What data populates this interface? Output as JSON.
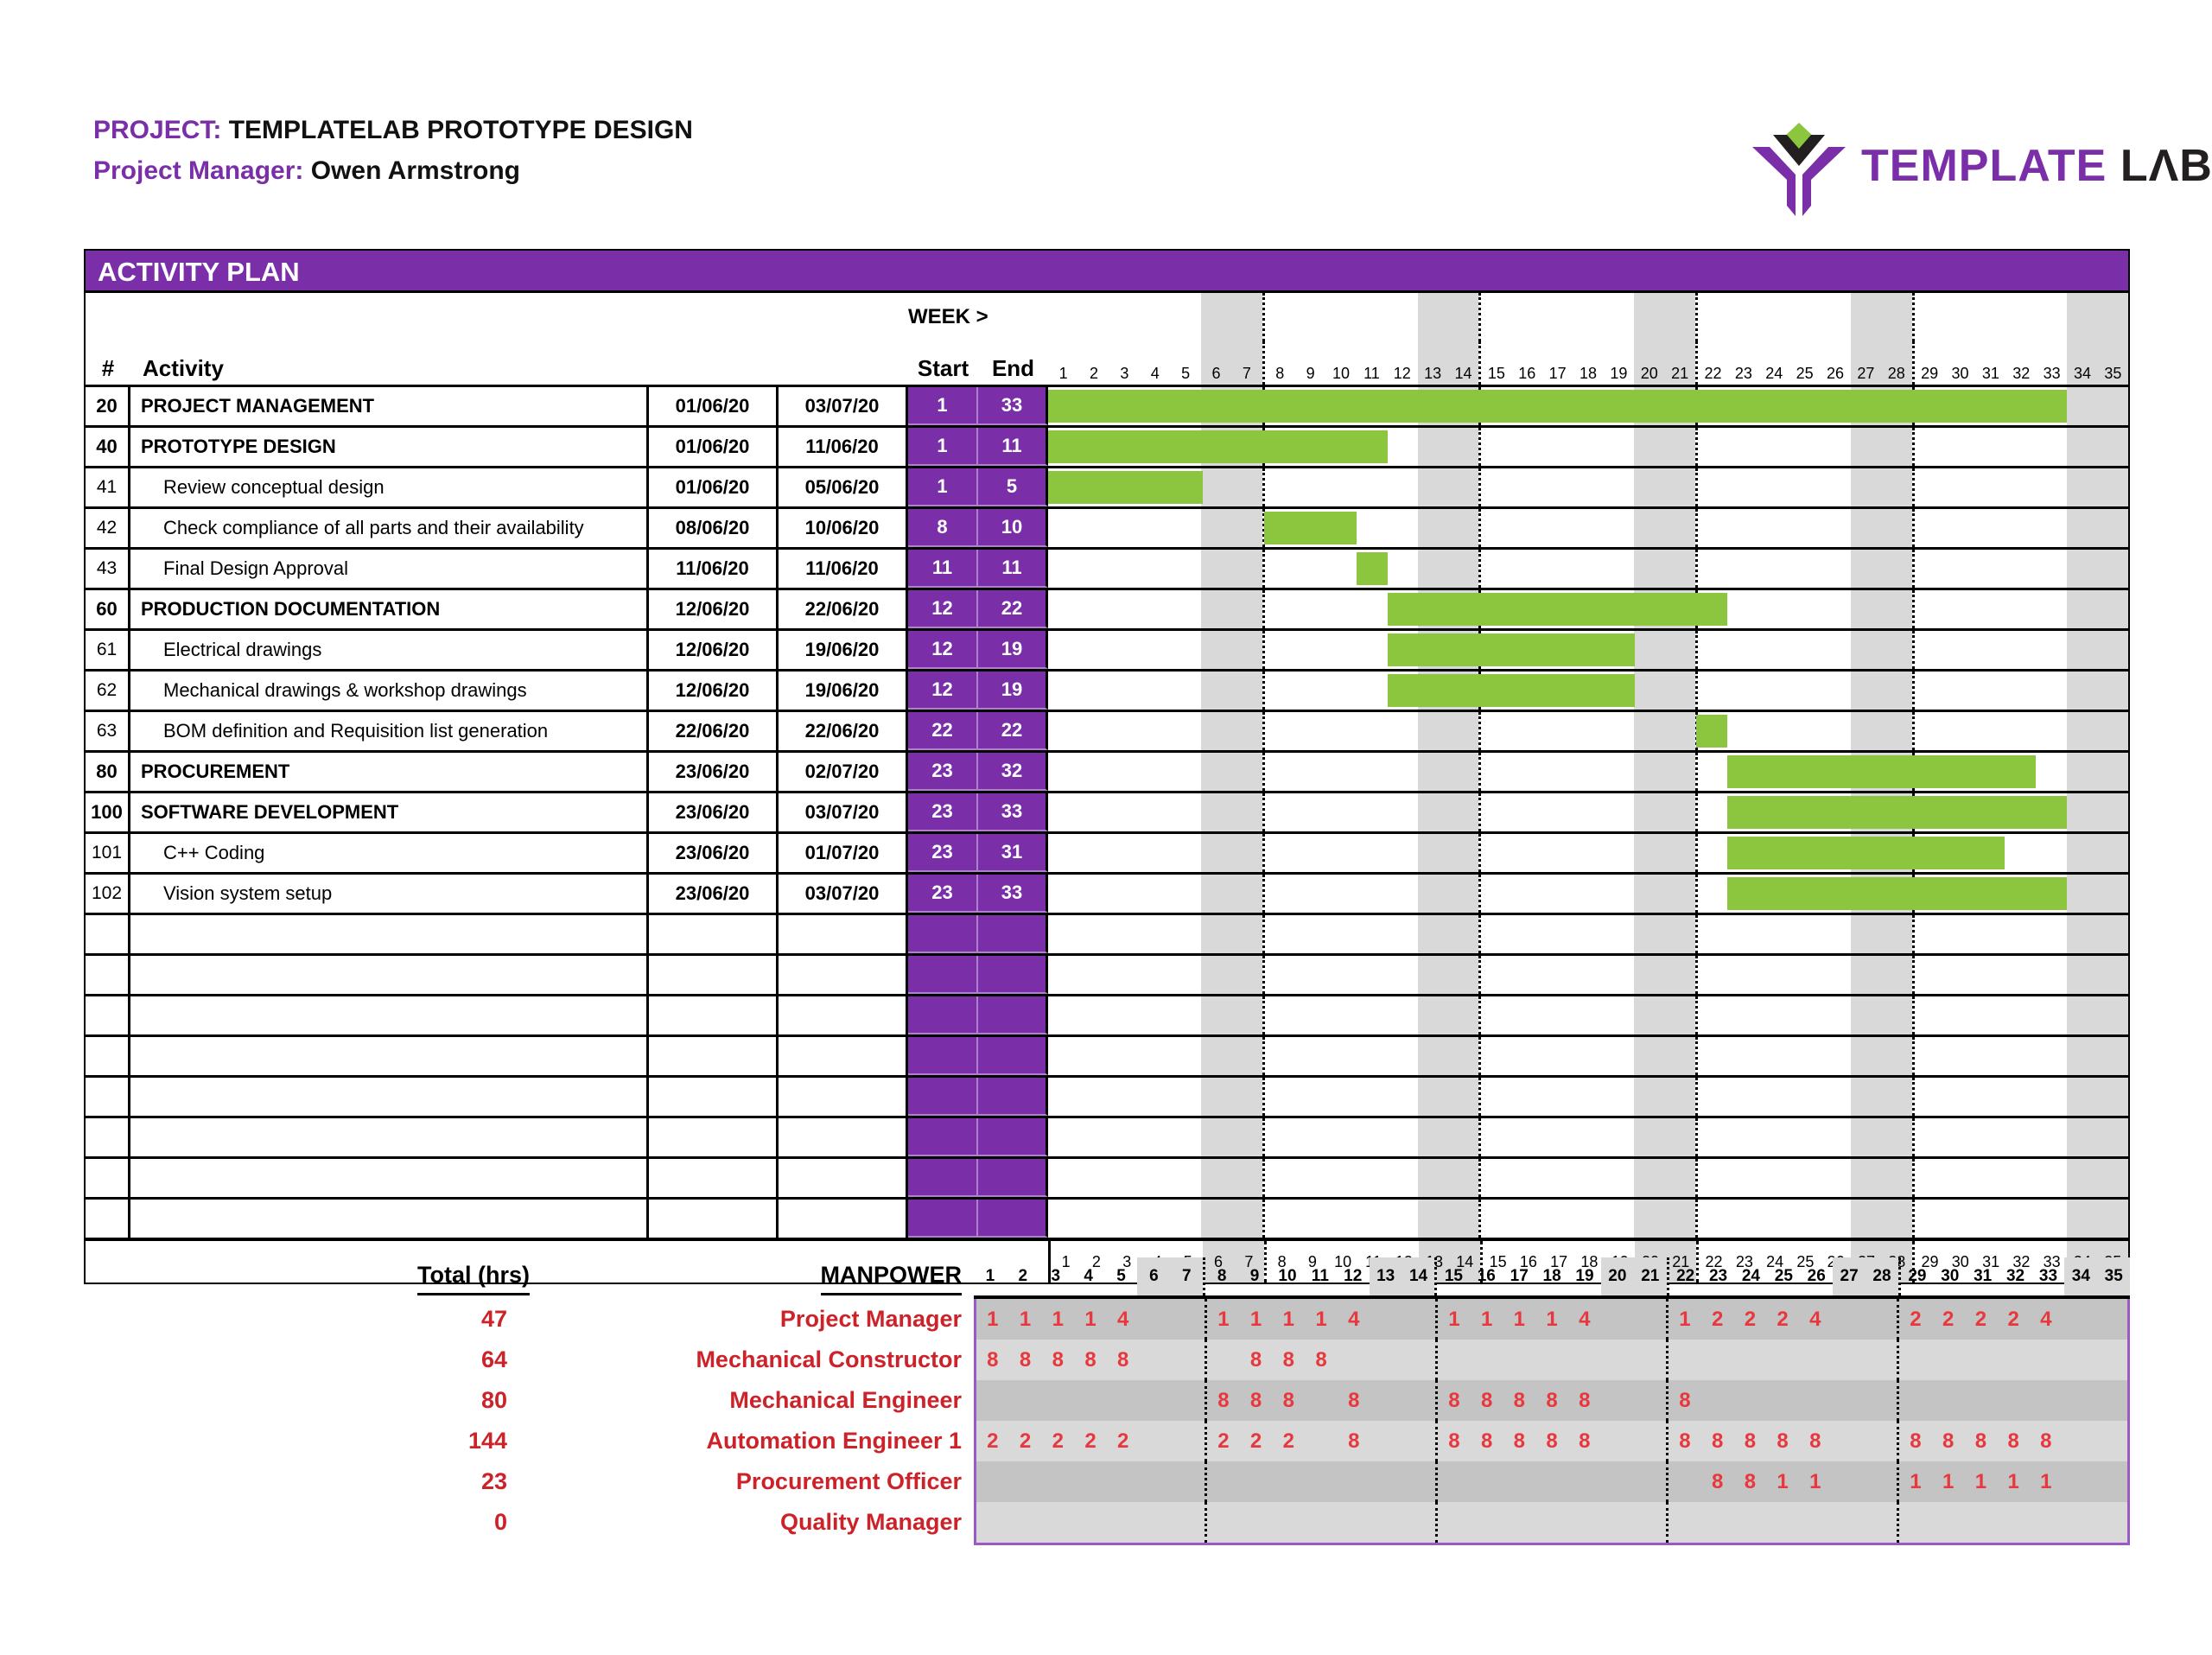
{
  "header": {
    "project_label": "PROJECT:",
    "project_name": "TEMPLATELAB PROTOTYPE DESIGN",
    "manager_label": "Project Manager:",
    "manager_name": "Owen Armstrong",
    "logo_text_primary": "TEMPLATE",
    "logo_text_secondary": "LΛB"
  },
  "panel": {
    "title": "ACTIVITY PLAN",
    "week_label": "WEEK >",
    "col_num": "#",
    "col_activity": "Activity",
    "col_start": "Start",
    "col_end": "End"
  },
  "calendar": {
    "days": [
      1,
      2,
      3,
      4,
      5,
      6,
      7,
      8,
      9,
      10,
      11,
      12,
      13,
      14,
      15,
      16,
      17,
      18,
      19,
      20,
      21,
      22,
      23,
      24,
      25,
      26,
      27,
      28,
      29,
      30,
      31,
      32,
      33,
      34,
      35
    ],
    "weekend_days": [
      6,
      7,
      13,
      14,
      20,
      21,
      27,
      28,
      34,
      35
    ],
    "week_start_days": [
      1,
      8,
      15,
      22,
      29
    ],
    "week_numbers": [
      1,
      2,
      3,
      4,
      5
    ],
    "total_days": 35
  },
  "activities": [
    {
      "num": "20",
      "name": "PROJECT MANAGEMENT",
      "start_date": "01/06/20",
      "end_date": "03/07/20",
      "start": 1,
      "end": 33,
      "bold": true
    },
    {
      "num": "40",
      "name": "PROTOTYPE DESIGN",
      "start_date": "01/06/20",
      "end_date": "11/06/20",
      "start": 1,
      "end": 11,
      "bold": true
    },
    {
      "num": "41",
      "name": "Review conceptual design",
      "start_date": "01/06/20",
      "end_date": "05/06/20",
      "start": 1,
      "end": 5,
      "bold": false
    },
    {
      "num": "42",
      "name": "Check compliance of all parts and their availability",
      "start_date": "08/06/20",
      "end_date": "10/06/20",
      "start": 8,
      "end": 10,
      "bold": false
    },
    {
      "num": "43",
      "name": "Final Design Approval",
      "start_date": "11/06/20",
      "end_date": "11/06/20",
      "start": 11,
      "end": 11,
      "bold": false
    },
    {
      "num": "60",
      "name": "PRODUCTION DOCUMENTATION",
      "start_date": "12/06/20",
      "end_date": "22/06/20",
      "start": 12,
      "end": 22,
      "bold": true
    },
    {
      "num": "61",
      "name": "Electrical drawings",
      "start_date": "12/06/20",
      "end_date": "19/06/20",
      "start": 12,
      "end": 19,
      "bold": false
    },
    {
      "num": "62",
      "name": "Mechanical drawings & workshop drawings",
      "start_date": "12/06/20",
      "end_date": "19/06/20",
      "start": 12,
      "end": 19,
      "bold": false
    },
    {
      "num": "63",
      "name": "BOM definition and Requisition list generation",
      "start_date": "22/06/20",
      "end_date": "22/06/20",
      "start": 22,
      "end": 22,
      "bold": false
    },
    {
      "num": "80",
      "name": "PROCUREMENT",
      "start_date": "23/06/20",
      "end_date": "02/07/20",
      "start": 23,
      "end": 32,
      "bold": true
    },
    {
      "num": "100",
      "name": "SOFTWARE DEVELOPMENT",
      "start_date": "23/06/20",
      "end_date": "03/07/20",
      "start": 23,
      "end": 33,
      "bold": true
    },
    {
      "num": "101",
      "name": "C++ Coding",
      "start_date": "23/06/20",
      "end_date": "01/07/20",
      "start": 23,
      "end": 31,
      "bold": false
    },
    {
      "num": "102",
      "name": "Vision system setup",
      "start_date": "23/06/20",
      "end_date": "03/07/20",
      "start": 23,
      "end": 33,
      "bold": false
    },
    {
      "num": "",
      "name": "",
      "start_date": "",
      "end_date": "",
      "start": null,
      "end": null,
      "bold": false
    },
    {
      "num": "",
      "name": "",
      "start_date": "",
      "end_date": "",
      "start": null,
      "end": null,
      "bold": false
    },
    {
      "num": "",
      "name": "",
      "start_date": "",
      "end_date": "",
      "start": null,
      "end": null,
      "bold": false
    },
    {
      "num": "",
      "name": "",
      "start_date": "",
      "end_date": "",
      "start": null,
      "end": null,
      "bold": false
    },
    {
      "num": "",
      "name": "",
      "start_date": "",
      "end_date": "",
      "start": null,
      "end": null,
      "bold": false
    },
    {
      "num": "",
      "name": "",
      "start_date": "",
      "end_date": "",
      "start": null,
      "end": null,
      "bold": false
    },
    {
      "num": "",
      "name": "",
      "start_date": "",
      "end_date": "",
      "start": null,
      "end": null,
      "bold": false
    },
    {
      "num": "",
      "name": "",
      "start_date": "",
      "end_date": "",
      "start": null,
      "end": null,
      "bold": false
    }
  ],
  "manpower": {
    "total_header": "Total (hrs)",
    "title": "MANPOWER",
    "roles": [
      {
        "name": "Project Manager",
        "total": "47",
        "hours": {
          "1": "1",
          "2": "1",
          "3": "1",
          "4": "1",
          "5": "4",
          "8": "1",
          "9": "1",
          "10": "1",
          "11": "1",
          "12": "4",
          "15": "1",
          "16": "1",
          "17": "1",
          "18": "1",
          "19": "4",
          "22": "1",
          "23": "2",
          "24": "2",
          "25": "2",
          "26": "4",
          "29": "2",
          "30": "2",
          "31": "2",
          "32": "2",
          "33": "4"
        }
      },
      {
        "name": "Mechanical Constructor",
        "total": "64",
        "hours": {
          "1": "8",
          "2": "8",
          "3": "8",
          "4": "8",
          "5": "8",
          "9": "8",
          "10": "8",
          "11": "8"
        }
      },
      {
        "name": "Mechanical Engineer",
        "total": "80",
        "hours": {
          "8": "8",
          "9": "8",
          "10": "8",
          "12": "8",
          "15": "8",
          "16": "8",
          "17": "8",
          "18": "8",
          "19": "8",
          "22": "8"
        }
      },
      {
        "name": "Automation Engineer 1",
        "total": "144",
        "hours": {
          "1": "2",
          "2": "2",
          "3": "2",
          "4": "2",
          "5": "2",
          "8": "2",
          "9": "2",
          "10": "2",
          "12": "8",
          "15": "8",
          "16": "8",
          "17": "8",
          "18": "8",
          "19": "8",
          "22": "8",
          "23": "8",
          "24": "8",
          "25": "8",
          "26": "8",
          "29": "8",
          "30": "8",
          "31": "8",
          "32": "8",
          "33": "8"
        }
      },
      {
        "name": "Procurement Officer",
        "total": "23",
        "hours": {
          "23": "8",
          "24": "8",
          "25": "1",
          "26": "1",
          "29": "1",
          "30": "1",
          "31": "1",
          "32": "1",
          "33": "1"
        }
      },
      {
        "name": "Quality Manager",
        "total": "0",
        "hours": {}
      }
    ]
  },
  "colors": {
    "purple": "#7A2FA8",
    "green": "#8CC63F",
    "red": "#CC2229",
    "weekend_gray": "#d9d9d9",
    "band_dark": "#c4c4c4",
    "band_light": "#d9d9d9"
  }
}
